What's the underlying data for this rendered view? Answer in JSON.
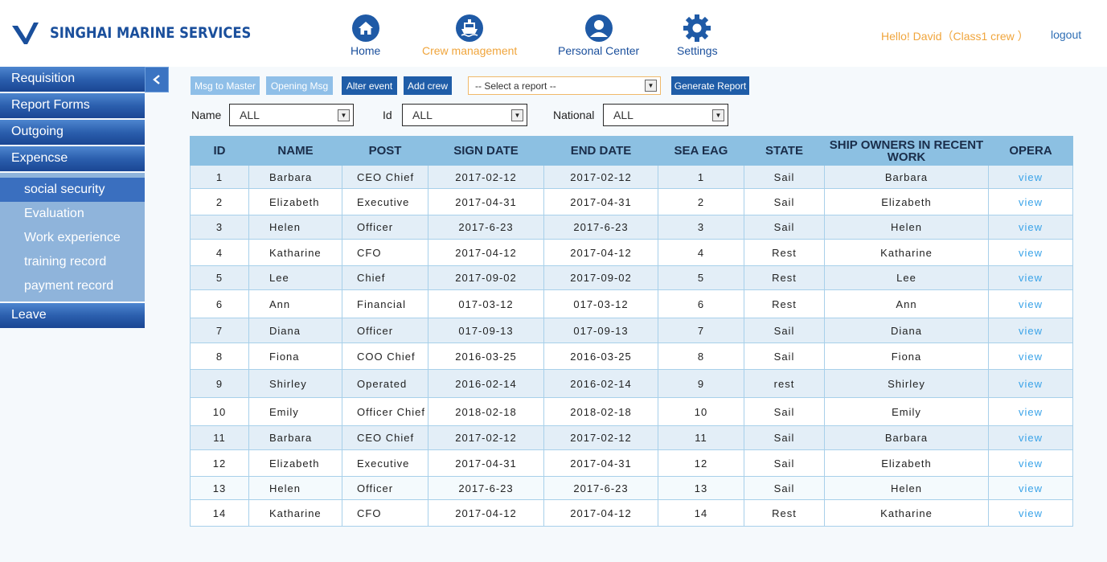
{
  "brand": {
    "name": "SINGHAI MARINE SERVICES",
    "color": "#1a4f9c"
  },
  "nav": [
    {
      "label": "Home",
      "icon": "home-icon",
      "active": false
    },
    {
      "label": "Crew management",
      "icon": "ship-icon",
      "active": true
    },
    {
      "label": "Personal Center",
      "icon": "user-icon",
      "active": false
    },
    {
      "label": "Settings",
      "icon": "gear-icon",
      "active": false
    }
  ],
  "user": {
    "greeting": "Hello! David（Class1 crew ）",
    "logout": "logout"
  },
  "sidebar": {
    "items": [
      "Requisition",
      "Report Forms",
      "Outgoing",
      "Expencse"
    ],
    "subitems": [
      "social security",
      "Evaluation",
      "Work experience",
      "training record",
      "payment record"
    ],
    "last_item": "Leave",
    "collapse_icon": "chevron-left-icon"
  },
  "toolbar": {
    "msg_to_master": "Msg to Master",
    "opening_msg": "Opening Msg",
    "alter_event": "Alter event",
    "add_crew": "Add crew",
    "report_select": "-- Select a report --",
    "generate_report": "Generate Report"
  },
  "filters": {
    "name_label": "Name",
    "name_value": "ALL",
    "id_label": "Id",
    "id_value": "ALL",
    "national_label": "National",
    "national_value": "ALL"
  },
  "table": {
    "headers": [
      "ID",
      "NAME",
      "POST",
      "SIGN DATE",
      "END DATE",
      "SEA EAG",
      "STATE",
      "SHIP OWNERS IN RECENT WORK",
      "OPERA"
    ],
    "rows": [
      [
        "1",
        "Barbara",
        "CEO  Chief",
        "2017-02-12",
        "2017-02-12",
        "1",
        "Sail",
        "Barbara",
        "view"
      ],
      [
        "2",
        "Elizabeth",
        "Executive",
        "2017-04-31",
        "2017-04-31",
        "2",
        "Sail",
        "Elizabeth",
        "view"
      ],
      [
        "3",
        "Helen",
        "Officer",
        "2017-6-23",
        "2017-6-23",
        "3",
        "Sail",
        "Helen",
        "view"
      ],
      [
        "4",
        "Katharine",
        "CFO",
        "2017-04-12",
        "2017-04-12",
        "4",
        "Rest",
        "Katharine",
        "view"
      ],
      [
        "5",
        "Lee",
        "Chief",
        "2017-09-02",
        "2017-09-02",
        "5",
        "Rest",
        "Lee",
        "view"
      ],
      [
        "6",
        "Ann",
        "Financial",
        "017-03-12",
        "017-03-12",
        "6",
        "Rest",
        "Ann",
        "view"
      ],
      [
        "7",
        "Diana",
        "Officer",
        "017-09-13",
        "017-09-13",
        "7",
        "Sail",
        "Diana",
        "view"
      ],
      [
        "8",
        "Fiona",
        "COO  Chief",
        "2016-03-25",
        "2016-03-25",
        "8",
        "Sail",
        "Fiona",
        "view"
      ],
      [
        "9",
        "Shirley",
        "Operated",
        "2016-02-14",
        "2016-02-14",
        "9",
        "rest",
        "Shirley",
        "view"
      ],
      [
        "10",
        "Emily",
        "Officer Chief",
        "2018-02-18",
        "2018-02-18",
        "10",
        "Sail",
        "Emily",
        "view"
      ],
      [
        "11",
        "Barbara",
        "CEO  Chief",
        "2017-02-12",
        "2017-02-12",
        "11",
        "Sail",
        "Barbara",
        "view"
      ],
      [
        "12",
        "Elizabeth",
        "Executive",
        "2017-04-31",
        "2017-04-31",
        "12",
        "Sail",
        "Elizabeth",
        "view"
      ],
      [
        "13",
        "Helen",
        "Officer",
        "2017-6-23",
        "2017-6-23",
        "13",
        "Sail",
        "Helen",
        "view"
      ],
      [
        "14",
        "Katharine",
        "CFO",
        "2017-04-12",
        "2017-04-12",
        "14",
        "Rest",
        "Katharine",
        "view"
      ]
    ]
  }
}
